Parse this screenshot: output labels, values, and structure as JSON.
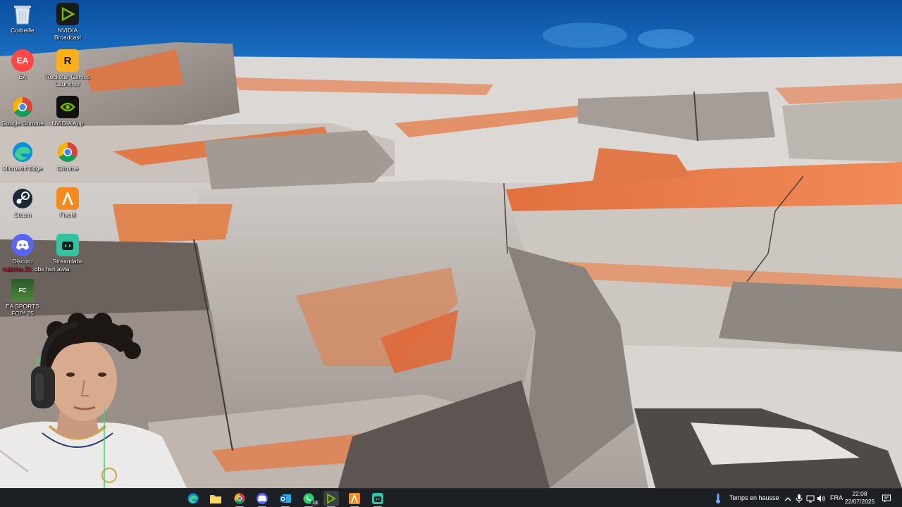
{
  "desktop": {
    "icons": [
      {
        "label": "Corbeille",
        "icon": "recycle-bin-icon"
      },
      {
        "label": "NVIDIA Broadcast",
        "icon": "nvidia-broadcast-icon"
      },
      {
        "label": "EA",
        "icon": "ea-app-icon"
      },
      {
        "label": "Rockstar Games Launcher",
        "icon": "rockstar-launcher-icon"
      },
      {
        "label": "Google Chrome",
        "icon": "google-chrome-icon"
      },
      {
        "label": "NVIDIA App",
        "icon": "nvidia-app-icon"
      },
      {
        "label": "Microsoft Edge",
        "icon": "microsoft-edge-icon"
      },
      {
        "label": "Chrome",
        "icon": "chrome-profile-icon"
      },
      {
        "label": "Steam",
        "icon": "steam-icon"
      },
      {
        "label": "FiveM",
        "icon": "fivem-icon"
      },
      {
        "label": "Discord",
        "icon": "discord-icon"
      },
      {
        "label": "Streamlabs",
        "icon": "streamlabs-icon"
      },
      {
        "label": "EA SPORTS FC™ 25",
        "icon": "ea-sports-fc-icon"
      }
    ],
    "chat_overlay": {
      "user": "rubinho.25",
      "message": ": obs hsn awla"
    }
  },
  "taskbar": {
    "apps": [
      {
        "name": "microsoft-edge",
        "icon": "edge-icon",
        "color": "#1fa0e0"
      },
      {
        "name": "file-explorer",
        "icon": "folder-icon",
        "color": "#f5c542"
      },
      {
        "name": "google-chrome",
        "icon": "chrome-icon",
        "color": "#34a853"
      },
      {
        "name": "discord",
        "icon": "discord-icon",
        "color": "#5865f2"
      },
      {
        "name": "outlook",
        "icon": "outlook-icon",
        "color": "#0f6cbd"
      },
      {
        "name": "whatsapp",
        "icon": "whatsapp-icon",
        "color": "#25d366",
        "badge": "14"
      },
      {
        "name": "nvidia-broadcast",
        "icon": "nvidia-broadcast-icon",
        "color": "#76b900"
      },
      {
        "name": "fivem",
        "icon": "fivem-icon",
        "color": "#f78a1d"
      },
      {
        "name": "streamlabs",
        "icon": "streamlabs-icon",
        "color": "#31c3a2"
      }
    ],
    "tray": {
      "weather_text": "Temps en hausse",
      "language": "FRA",
      "time": "22:08",
      "date": "22/07/2025"
    }
  }
}
